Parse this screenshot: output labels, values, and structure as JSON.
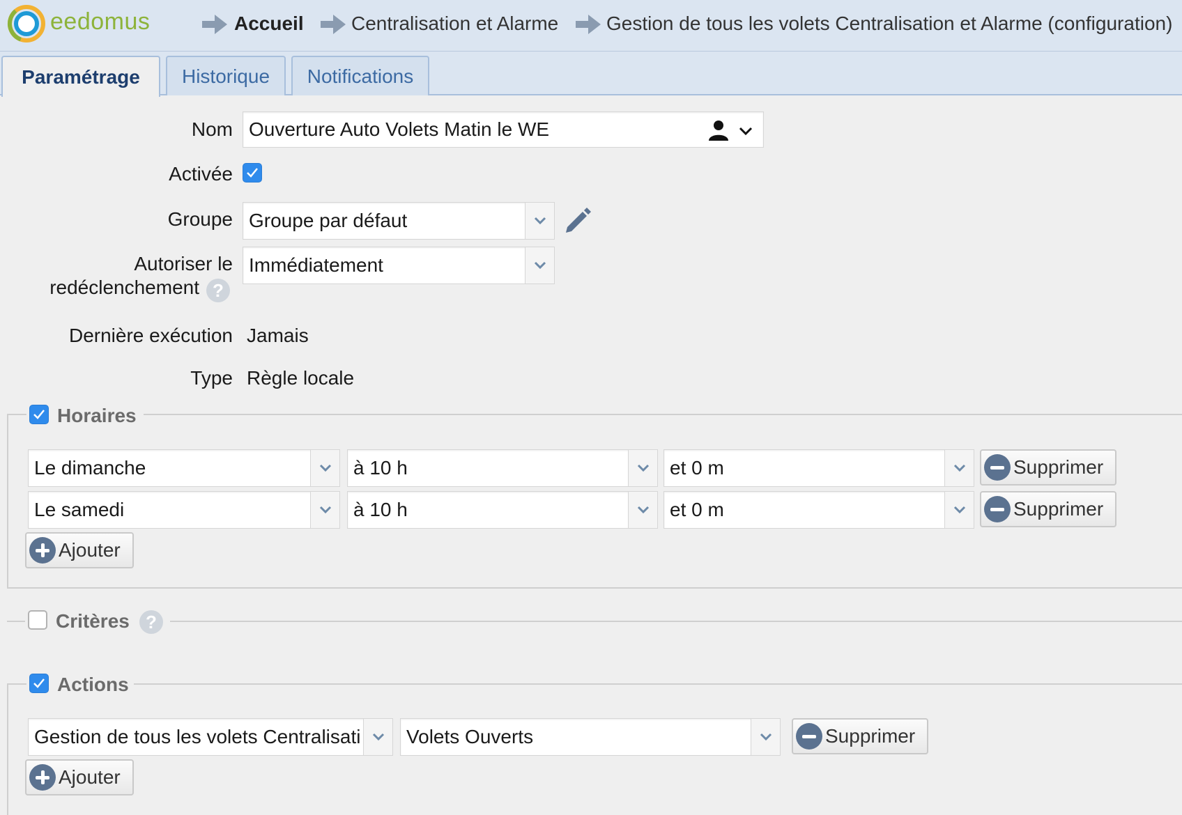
{
  "header": {
    "logo_text": "eedomus",
    "breadcrumb": [
      "Accueil",
      "Centralisation et Alarme",
      "Gestion de tous les volets Centralisation et Alarme (configuration)"
    ]
  },
  "tabs": [
    "Paramétrage",
    "Historique",
    "Notifications"
  ],
  "form": {
    "name_label": "Nom",
    "name_value": "Ouverture Auto Volets Matin le WE",
    "enabled_label": "Activée",
    "enabled": true,
    "group_label": "Groupe",
    "group_value": "Groupe par défaut",
    "retrigger_label_line1": "Autoriser le",
    "retrigger_label_line2": "redéclenchement",
    "retrigger_value": "Immédiatement",
    "last_exec_label": "Dernière exécution",
    "last_exec_value": "Jamais",
    "type_label": "Type",
    "type_value": "Règle locale",
    "help_glyph": "?"
  },
  "schedules": {
    "legend": "Horaires",
    "enabled": true,
    "rows": [
      {
        "day": "Le dimanche",
        "hour": "à 10 h",
        "minute": "et 0 m"
      },
      {
        "day": "Le samedi",
        "hour": "à 10 h",
        "minute": "et 0 m"
      }
    ],
    "delete_label": "Supprimer",
    "add_label": "Ajouter"
  },
  "criteria": {
    "legend": "Critères",
    "enabled": false
  },
  "actions": {
    "legend": "Actions",
    "enabled": true,
    "rows": [
      {
        "device": "Gestion de tous les volets Centralisation et Alarme",
        "value": "Volets Ouverts"
      }
    ],
    "delete_label": "Supprimer",
    "add_label": "Ajouter"
  },
  "colors": {
    "header_bg": "#dbe5f1",
    "logo_green": "#8db33a",
    "tab_text": "#3c6aa3",
    "checkbox_blue": "#2f8bec",
    "button_icon": "#5b7290"
  },
  "icons": {
    "breadcrumb_separator": "arrow-right-icon",
    "name_owner": "user-icon",
    "group_edit": "pencil-icon",
    "dropdown": "chevron-down-icon",
    "delete": "minus-circle-icon",
    "add": "plus-circle-icon"
  }
}
